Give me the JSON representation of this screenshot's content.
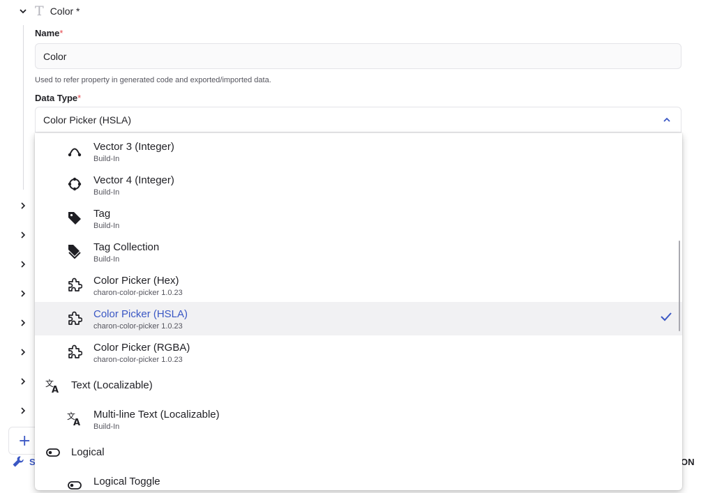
{
  "property": {
    "title": "Color *",
    "name_label": "Name",
    "required_mark": "*",
    "name_value": "Color",
    "name_help": "Used to refer property in generated code and exported/imported data.",
    "type_label": "Data Type",
    "type_value": "Color Picker (HSLA)"
  },
  "dropdown": {
    "items": [
      {
        "label": "Vector 3 (Integer)",
        "sub": "Build-In",
        "icon": "vector3-icon"
      },
      {
        "label": "Vector 4 (Integer)",
        "sub": "Build-In",
        "icon": "vector4-icon"
      },
      {
        "label": "Tag",
        "sub": "Build-In",
        "icon": "tag-icon"
      },
      {
        "label": "Tag Collection",
        "sub": "Build-In",
        "icon": "tags-icon"
      },
      {
        "label": "Color Picker (Hex)",
        "sub": "charon-color-picker 1.0.23",
        "icon": "puzzle-icon"
      },
      {
        "label": "Color Picker (HSLA)",
        "sub": "charon-color-picker 1.0.23",
        "icon": "puzzle-icon",
        "selected": true
      },
      {
        "label": "Color Picker (RGBA)",
        "sub": "charon-color-picker 1.0.23",
        "icon": "puzzle-icon"
      },
      {
        "label": "Multi-line Text (Localizable)",
        "sub": "Build-In",
        "icon": "translate-icon"
      },
      {
        "label": "Logical Toggle",
        "icon": "toggle-icon"
      }
    ],
    "groups": [
      {
        "label": "Text (Localizable)",
        "icon": "translate-icon"
      },
      {
        "label": "Logical",
        "icon": "toggle-icon"
      }
    ]
  },
  "footer": {
    "s_fragment": "S",
    "on_fragment": "ON"
  },
  "colors": {
    "accent": "#3a57c4",
    "required": "#e5484d",
    "selected_bg": "#f1f1f3"
  }
}
